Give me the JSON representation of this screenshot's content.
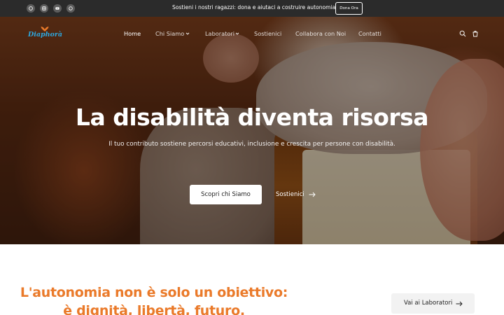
{
  "topbar": {
    "social_icons": [
      "facebook-icon",
      "instagram-icon",
      "youtube-icon",
      "whatsapp-icon"
    ],
    "message": "Sostieni i nostri ragazzi: dona e aiutaci a costruire autonomia",
    "donate_label": "Dona Ora",
    "background": "#2b2b2b"
  },
  "header": {
    "logo_text": "Diaphorà",
    "nav": [
      {
        "label": "Home",
        "active": true,
        "dropdown": false
      },
      {
        "label": "Chi Siamo",
        "active": false,
        "dropdown": true
      },
      {
        "label": "Laboratori",
        "active": false,
        "dropdown": true
      },
      {
        "label": "Sostienici",
        "active": false,
        "dropdown": false
      },
      {
        "label": "Collabora con Noi",
        "active": false,
        "dropdown": false
      },
      {
        "label": "Contatti",
        "active": false,
        "dropdown": false
      }
    ],
    "icons": [
      "search-icon",
      "cart-icon"
    ]
  },
  "hero": {
    "title": "La disabilità diventa risorsa",
    "subtitle": "Il tuo contributo sostiene percorsi educativi, inclusione e crescita per persone con disabilità.",
    "primary_cta": "Scopri chi Siamo",
    "secondary_cta": "Sostienici"
  },
  "mission": {
    "line1": "L'autonomia non è solo un obiettivo:",
    "line2": "è dignità, libertà, futuro.",
    "button_label": "Vai ai Laboratori",
    "accent_color": "#ea7a2a"
  },
  "brand_color": "#2da8e0"
}
